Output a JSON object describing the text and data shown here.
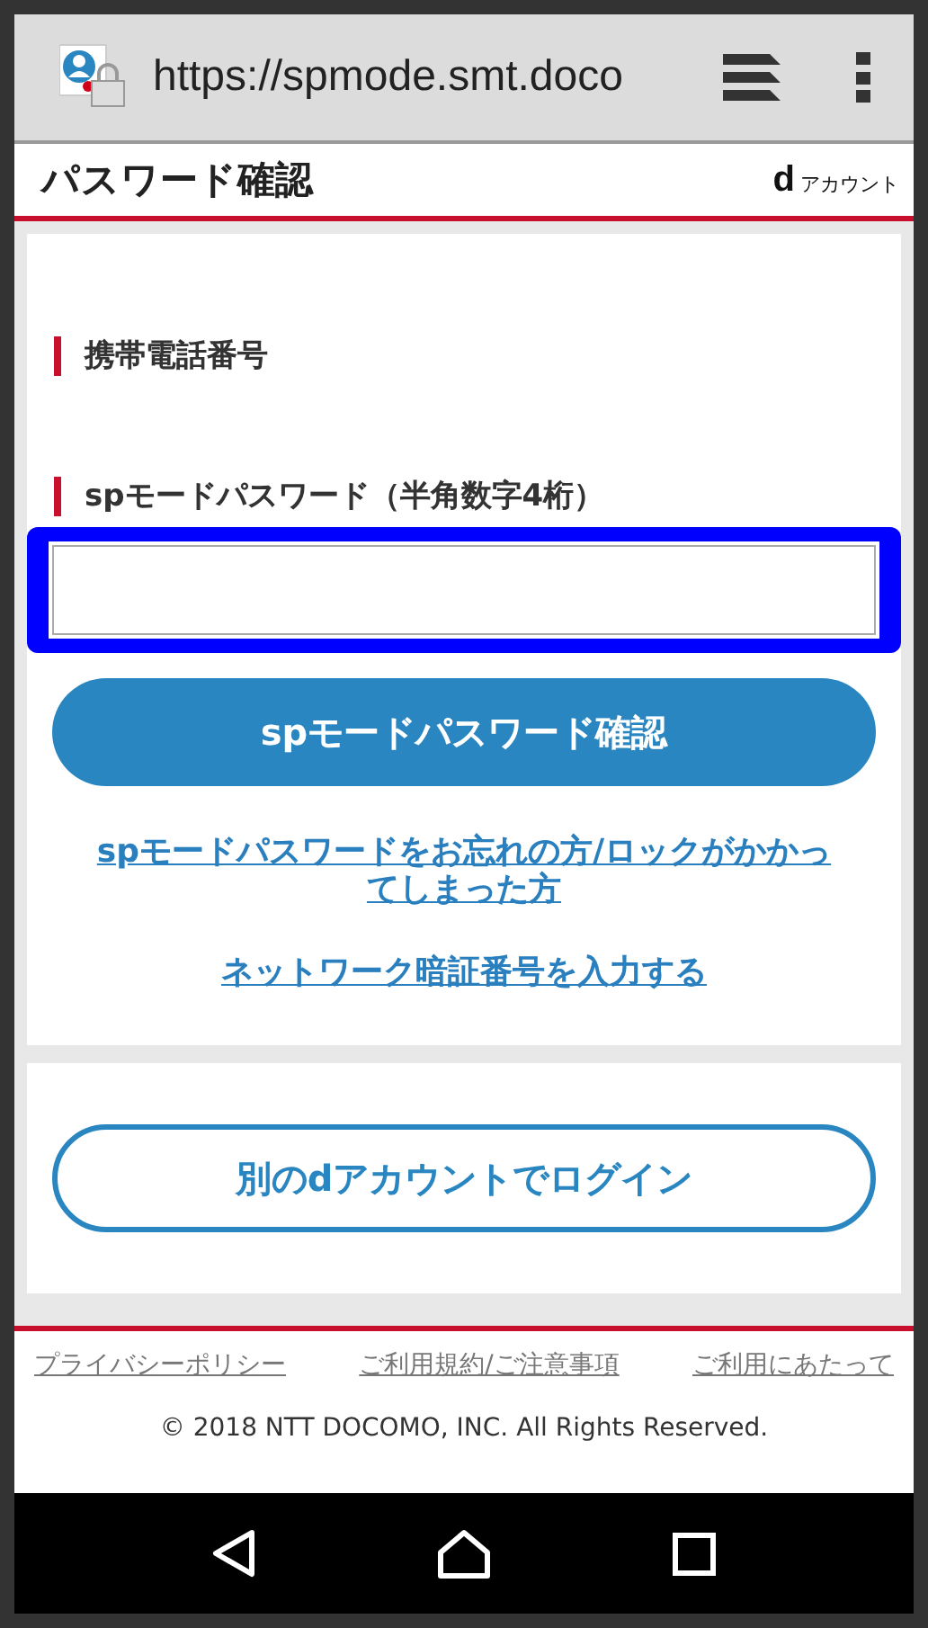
{
  "browser": {
    "url": "https://spmode.smt.doco"
  },
  "header": {
    "title": "パスワード確認",
    "logo_mark": "d",
    "logo_text": "アカウント"
  },
  "form": {
    "fields": [
      {
        "kind": "static",
        "label": "携帯電話番号"
      },
      {
        "kind": "input",
        "label": "spモードパスワード（半角数字4桁）",
        "highlighted": true
      }
    ],
    "submit": "spモードパスワード確認",
    "links": [
      "spモードパスワードをお忘れの方/ロックがかかってしまった方",
      "ネットワーク暗証番号を入力する"
    ]
  },
  "alt_login": {
    "button": "別のdアカウントでログイン"
  },
  "footer": {
    "links": [
      "プライバシーポリシー",
      "ご利用規約/ご注意事項",
      "ご利用にあたって"
    ],
    "copyright": "© 2018 NTT DOCOMO, INC. All Rights Reserved."
  }
}
